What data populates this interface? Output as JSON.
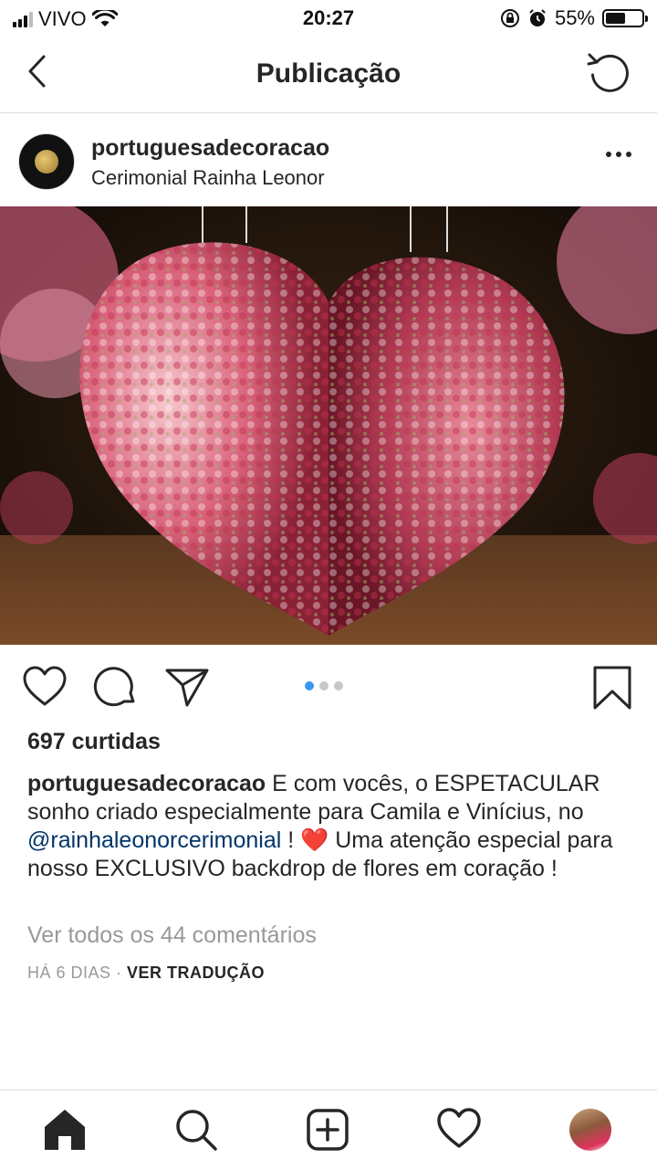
{
  "status_bar": {
    "carrier": "VIVO",
    "time": "20:27",
    "battery_percent": "55%",
    "battery_level": 0.55
  },
  "nav": {
    "title": "Publicação"
  },
  "post": {
    "username": "portuguesadecoracao",
    "location": "Cerimonial Rainha Leonor",
    "carousel_page": 1,
    "carousel_total": 3,
    "likes": "697 curtidas",
    "caption": {
      "username": "portuguesadecoracao",
      "text_before_mention": " E com vocês, o ESPETACULAR sonho criado especialmente para Camila e Vinícius, no ",
      "mention": "@rainhaleonorcerimonial",
      "text_after_mention": " ! ❤️ Uma atenção especial para nosso EXCLUSIVO backdrop de flores em coração !"
    },
    "view_comments": "Ver todos os 44 comentários",
    "time_ago": "HÁ 6 DIAS",
    "separator": " · ",
    "translate": "VER TRADUÇÃO"
  },
  "icons": {
    "back": "chevron-left-icon",
    "refresh": "refresh-icon",
    "more": "more-horizontal-icon",
    "like": "heart-icon",
    "comment": "comment-icon",
    "share": "send-icon",
    "save": "bookmark-icon",
    "home": "home-icon",
    "search": "search-icon",
    "new_post": "plus-square-icon",
    "activity": "heart-icon"
  },
  "colors": {
    "accent_blue": "#3897f0",
    "mention": "#003569",
    "muted_text": "#999999"
  }
}
